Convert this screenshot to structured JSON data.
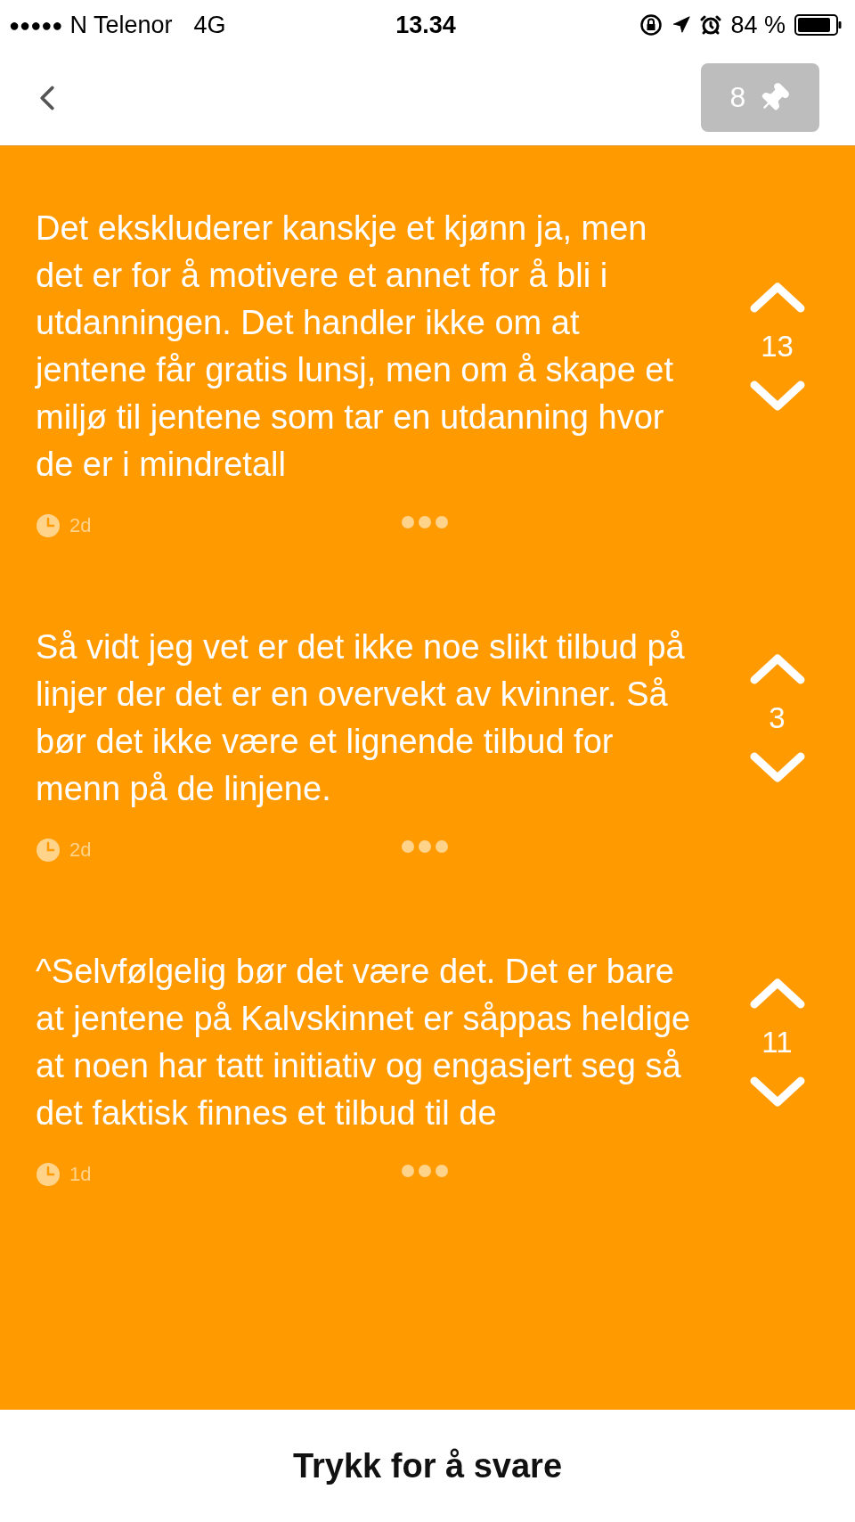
{
  "status_bar": {
    "signal": "●●●●●",
    "carrier": "N Telenor",
    "network": "4G",
    "time": "13.34",
    "battery": "84 %"
  },
  "header": {
    "pin_count": "8"
  },
  "posts": [
    {
      "text": "Det ekskluderer kanskje et kjønn ja, men det er for å motivere et annet for å bli i utdanningen. Det handler ikke om at jentene får gratis lunsj, men om å skape et miljø til jentene som tar en utdanning hvor de er i mindretall",
      "votes": "13",
      "age": "2d"
    },
    {
      "text": "Så vidt jeg vet er det ikke noe slikt tilbud på linjer der det er en overvekt av kvinner. Så bør det ikke være et lignende tilbud for menn på de linjene.",
      "votes": "3",
      "age": "2d"
    },
    {
      "text": "^Selvfølgelig bør det være det. Det er bare at jentene på Kalvskinnet er såppas heldige at noen har tatt initiativ og engasjert seg så det faktisk finnes et tilbud til de",
      "votes": "11",
      "age": "1d"
    }
  ],
  "reply_bar": {
    "label": "Trykk for å svare"
  }
}
